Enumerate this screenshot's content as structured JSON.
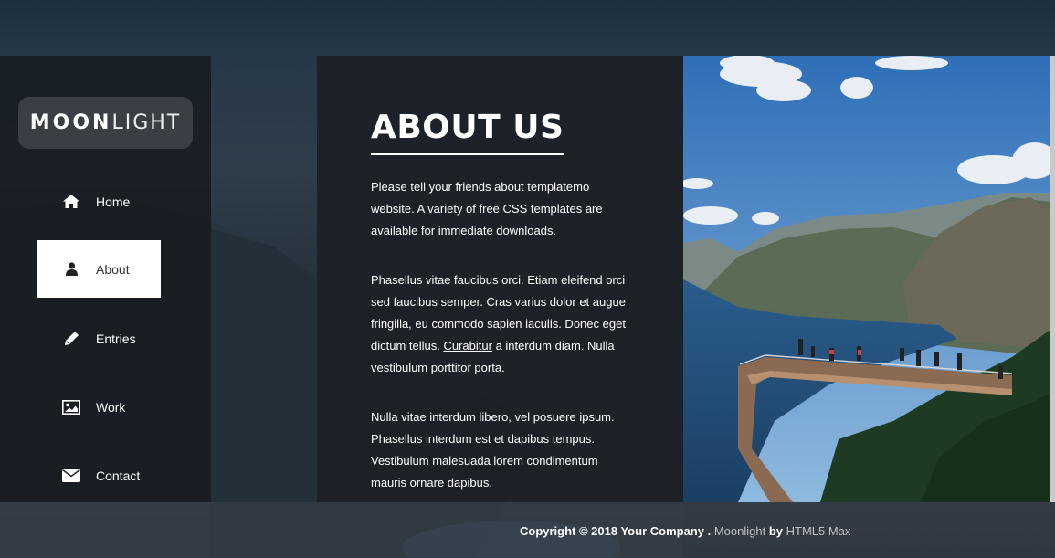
{
  "brand": {
    "bold": "MOON",
    "light": "LIGHT"
  },
  "nav": [
    {
      "label": "Home",
      "icon": "home-icon"
    },
    {
      "label": "About",
      "icon": "user-icon",
      "active": true
    },
    {
      "label": "Entries",
      "icon": "pencil-icon"
    },
    {
      "label": "Work",
      "icon": "image-icon"
    },
    {
      "label": "Contact",
      "icon": "envelope-icon"
    }
  ],
  "about": {
    "title": "ABOUT US",
    "p1": "Please tell your friends about templatemo website. A variety of free CSS templates are available for immediate downloads.",
    "p2_before": "Phasellus vitae faucibus orci. Etiam eleifend orci sed faucibus semper. Cras varius dolor et augue fringilla, eu commodo sapien iaculis. Donec eget dictum tellus. ",
    "p2_link": "Curabitur",
    "p2_after": " a interdum diam. Nulla vestibulum porttitor porta.",
    "p3": "Nulla vitae interdum libero, vel posuere ipsum. Phasellus interdum est et dapibus tempus. Vestibulum malesuada lorem condimentum mauris ornare dapibus."
  },
  "footer": {
    "copyright": "Copyright © 2018 Your Company .",
    "site": "Moonlight",
    "by": "by",
    "author": "HTML5 Max"
  },
  "colors": {
    "sidebar_bg": "#16191e",
    "panel_bg": "#1c2026",
    "active_bg": "#ffffff",
    "text": "#ffffff"
  }
}
